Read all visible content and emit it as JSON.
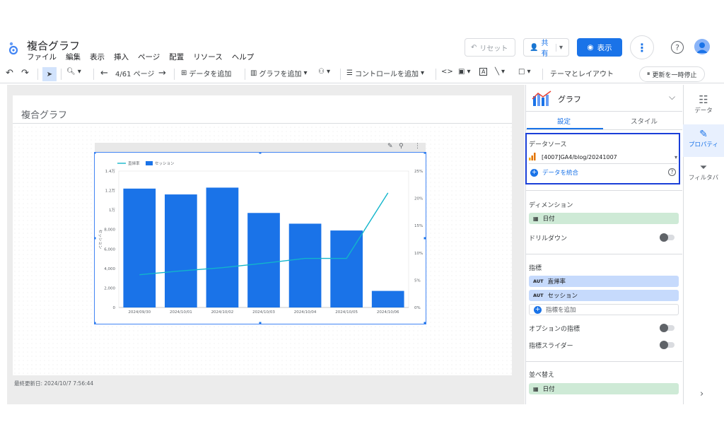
{
  "app": {
    "title": "複合グラフ"
  },
  "menu": [
    "ファイル",
    "編集",
    "表示",
    "挿入",
    "ページ",
    "配置",
    "リソース",
    "ヘルプ"
  ],
  "header_buttons": {
    "reset": "リセット",
    "share": "共有",
    "view": "表示"
  },
  "toolbar": {
    "page_indicator": "4/61 ページ",
    "add_data": "データを追加",
    "add_chart": "グラフを追加",
    "add_control": "コントロールを追加",
    "theme_layout": "テーマとレイアウト",
    "pause_update": "更新を一時停止"
  },
  "report": {
    "page_title": "複合グラフ",
    "last_updated": "最終更新日: 2024/10/7 7:56:44"
  },
  "chart_data": {
    "type": "bar",
    "categories": [
      "2024/09/30",
      "2024/10/01",
      "2024/10/02",
      "2024/10/03",
      "2024/10/04",
      "2024/10/05",
      "2024/10/06"
    ],
    "series": [
      {
        "name": "セッション",
        "type": "bar",
        "axis": "left",
        "color": "#1a73e8",
        "values": [
          12200,
          11600,
          12300,
          9700,
          8600,
          7900,
          1700
        ]
      },
      {
        "name": "直帰率",
        "type": "line",
        "axis": "right",
        "color": "#12b5cb",
        "values": [
          6,
          6.7,
          7.3,
          8.1,
          9,
          9,
          21
        ]
      }
    ],
    "left_ticks": [
      "0",
      "2,000",
      "4,000",
      "6,000",
      "8,000",
      "1万",
      "1.2万",
      "1.4万"
    ],
    "right_ticks": [
      "0%",
      "5%",
      "10%",
      "15%",
      "20%",
      "25%"
    ],
    "ylabel": "セッション",
    "ylim": [
      0,
      14000
    ],
    "y2lim": [
      0,
      25
    ],
    "legend": "top-left"
  },
  "panel": {
    "header": "グラフ",
    "tabs": [
      "設定",
      "スタイル"
    ],
    "datasource_label": "データソース",
    "datasource": "[4007]GA4/blog/20241007",
    "blend_data": "データを統合",
    "dimension_label": "ディメンション",
    "dimension": "日付",
    "drilldown_label": "ドリルダウン",
    "metrics_label": "指標",
    "metrics": [
      {
        "tag": "AUT",
        "name": "直帰率"
      },
      {
        "tag": "AUT",
        "name": "セッション"
      }
    ],
    "add_metric": "指標を追加",
    "optional_metrics": "オプションの指標",
    "metric_slider": "指標スライダー",
    "sort_label": "並べ替え",
    "sort": "日付"
  },
  "rail": {
    "data": "データ",
    "properties": "プロパティ",
    "filter": "フィルタバ"
  },
  "colors": {
    "accent": "#1a73e8",
    "line": "#12b5cb",
    "dimension_chip": "#ceead6",
    "metric_chip": "#c6dafc"
  }
}
